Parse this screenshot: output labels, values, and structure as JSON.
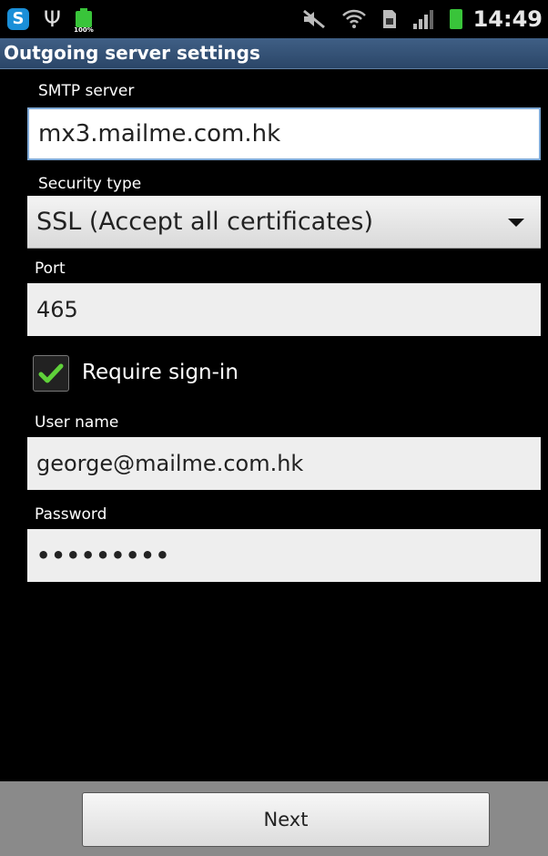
{
  "status_bar": {
    "time": "14:49",
    "battery_small_label": "100%",
    "icons": [
      "skype-icon",
      "usb-icon",
      "battery-full-icon",
      "mute-icon",
      "wifi-icon",
      "sim-icon",
      "signal-icon",
      "battery-icon"
    ]
  },
  "header": {
    "title": "Outgoing server settings"
  },
  "form": {
    "smtp_label": "SMTP server",
    "smtp_value": "mx3.mailme.com.hk",
    "security_label": "Security type",
    "security_value": "SSL (Accept all certificates)",
    "port_label": "Port",
    "port_value": "465",
    "require_signin_label": "Require sign-in",
    "require_signin_checked": true,
    "username_label": "User name",
    "username_value": "george@mailme.com.hk",
    "password_label": "Password",
    "password_value": "•••••••••"
  },
  "footer": {
    "next_label": "Next"
  },
  "colors": {
    "title_bar": "#2f4c70",
    "check": "#5fd13a",
    "battery": "#39c43a"
  }
}
